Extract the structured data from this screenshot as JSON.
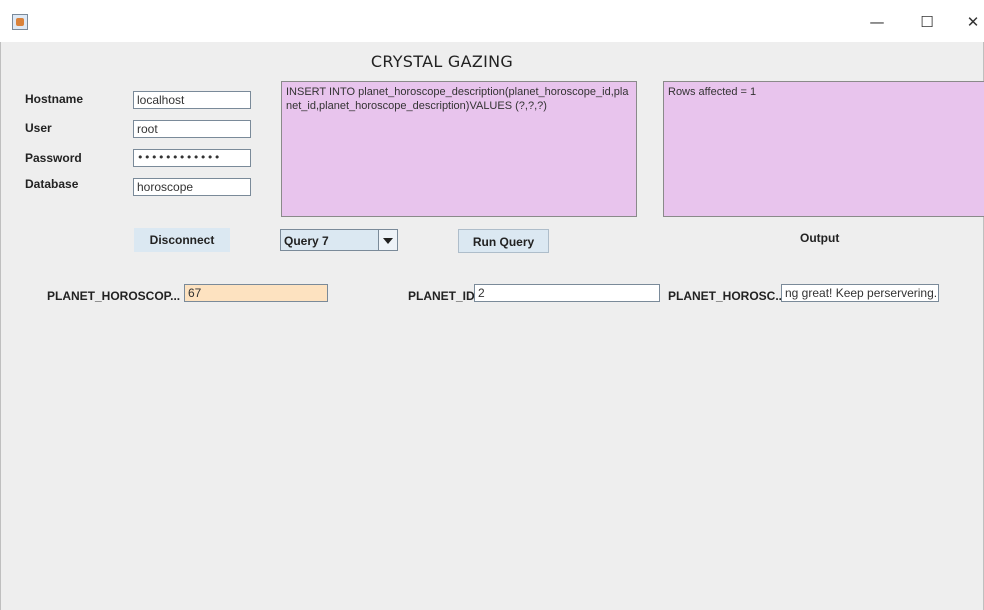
{
  "window": {
    "minimize_glyph": "—",
    "maximize_glyph": "☐",
    "close_glyph": "✕"
  },
  "title": "CRYSTAL GAZING",
  "connection": {
    "hostname_label": "Hostname",
    "hostname_value": "localhost",
    "user_label": "User",
    "user_value": "root",
    "password_label": "Password",
    "password_value": "••••••••••••",
    "database_label": "Database",
    "database_value": "horoscope"
  },
  "query_text": "INSERT INTO planet_horoscope_description(planet_horoscope_id,planet_id,planet_horoscope_description)VALUES (?,?,?)",
  "output_text": "Rows affected = 1",
  "buttons": {
    "disconnect": "Disconnect",
    "run_query": "Run Query"
  },
  "query_select": {
    "selected": "Query 7"
  },
  "output_label": "Output",
  "params": [
    {
      "label": "PLANET_HOROSCOP...",
      "value": "67"
    },
    {
      "label": "PLANET_ID",
      "value": "2"
    },
    {
      "label": "PLANET_HOROSC...",
      "value": "ng great! Keep perservering."
    }
  ],
  "colors": {
    "text_area_bg": "#e8c4ed",
    "button_bg": "#dbe8f2",
    "highlight_field_bg": "#fde2c0"
  }
}
